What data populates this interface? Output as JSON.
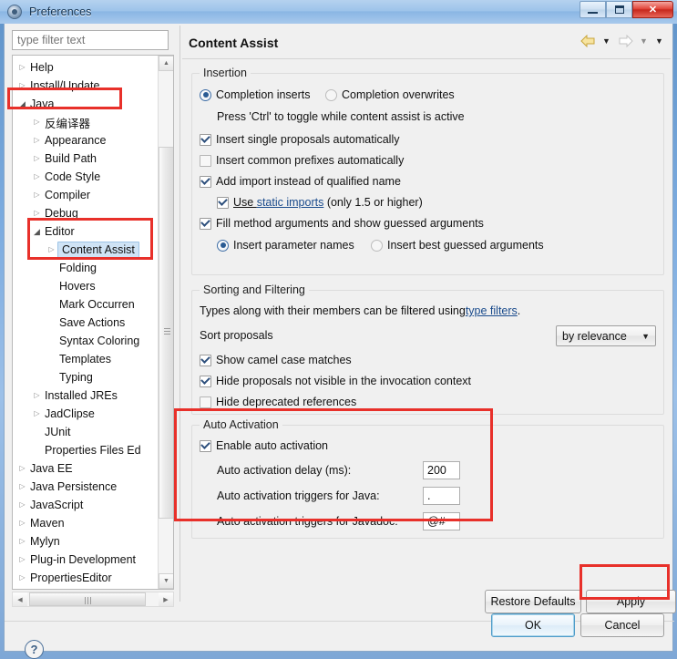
{
  "window": {
    "title": "Preferences",
    "icon": "preferences-gear-icon",
    "minimize_label": "–",
    "maximize_label": "□",
    "close_label": "✕"
  },
  "sidebar": {
    "filter_placeholder": "type filter text",
    "filter_value": "",
    "items": [
      {
        "label": "Help",
        "indent": 0,
        "arrow": "closed",
        "selected": false
      },
      {
        "label": "Install/Update",
        "indent": 0,
        "arrow": "closed",
        "selected": false
      },
      {
        "label": "Java",
        "indent": 0,
        "arrow": "open",
        "selected": false
      },
      {
        "label": "反编译器",
        "indent": 1,
        "arrow": "closed",
        "selected": false
      },
      {
        "label": "Appearance",
        "indent": 1,
        "arrow": "closed",
        "selected": false
      },
      {
        "label": "Build Path",
        "indent": 1,
        "arrow": "closed",
        "selected": false
      },
      {
        "label": "Code Style",
        "indent": 1,
        "arrow": "closed",
        "selected": false
      },
      {
        "label": "Compiler",
        "indent": 1,
        "arrow": "closed",
        "selected": false
      },
      {
        "label": "Debug",
        "indent": 1,
        "arrow": "closed",
        "selected": false
      },
      {
        "label": "Editor",
        "indent": 1,
        "arrow": "open",
        "selected": false
      },
      {
        "label": "Content Assist",
        "indent": 2,
        "arrow": "closed",
        "selected": true
      },
      {
        "label": "Folding",
        "indent": 2,
        "arrow": "none",
        "selected": false
      },
      {
        "label": "Hovers",
        "indent": 2,
        "arrow": "none",
        "selected": false
      },
      {
        "label": "Mark Occurren",
        "indent": 2,
        "arrow": "none",
        "selected": false
      },
      {
        "label": "Save Actions",
        "indent": 2,
        "arrow": "none",
        "selected": false
      },
      {
        "label": "Syntax Coloring",
        "indent": 2,
        "arrow": "none",
        "selected": false
      },
      {
        "label": "Templates",
        "indent": 2,
        "arrow": "none",
        "selected": false
      },
      {
        "label": "Typing",
        "indent": 2,
        "arrow": "none",
        "selected": false
      },
      {
        "label": "Installed JREs",
        "indent": 1,
        "arrow": "closed",
        "selected": false
      },
      {
        "label": "JadClipse",
        "indent": 1,
        "arrow": "closed",
        "selected": false
      },
      {
        "label": "JUnit",
        "indent": 1,
        "arrow": "none",
        "selected": false
      },
      {
        "label": "Properties Files Ed",
        "indent": 1,
        "arrow": "none",
        "selected": false
      },
      {
        "label": "Java EE",
        "indent": 0,
        "arrow": "closed",
        "selected": false
      },
      {
        "label": "Java Persistence",
        "indent": 0,
        "arrow": "closed",
        "selected": false
      },
      {
        "label": "JavaScript",
        "indent": 0,
        "arrow": "closed",
        "selected": false
      },
      {
        "label": "Maven",
        "indent": 0,
        "arrow": "closed",
        "selected": false
      },
      {
        "label": "Mylyn",
        "indent": 0,
        "arrow": "closed",
        "selected": false
      },
      {
        "label": "Plug-in Development",
        "indent": 0,
        "arrow": "closed",
        "selected": false
      },
      {
        "label": "PropertiesEditor",
        "indent": 0,
        "arrow": "closed",
        "selected": false
      }
    ]
  },
  "page": {
    "title": "Content Assist",
    "nav": {
      "back_icon": "back-arrow-icon",
      "back_menu_icon": "chevron-down-icon",
      "forward_icon": "forward-arrow-icon",
      "forward_menu_icon": "chevron-down-icon",
      "view_menu_icon": "chevron-down-icon"
    },
    "insertion": {
      "legend": "Insertion",
      "radio_inserts": "Completion inserts",
      "radio_overwrites": "Completion overwrites",
      "hint": "Press 'Ctrl' to toggle while content assist is active",
      "cb_single": "Insert single proposals automatically",
      "cb_prefixes": "Insert common prefixes automatically",
      "cb_addimport": "Add import instead of qualified name",
      "cb_static_pre": "Use ",
      "cb_static_link": "static imports",
      "cb_static_post": " (only 1.5 or higher)",
      "cb_fillargs": "Fill method arguments and show guessed arguments",
      "radio_paramnames": "Insert parameter names",
      "radio_bestguess": "Insert best guessed arguments"
    },
    "sorting": {
      "legend": "Sorting and Filtering",
      "desc_pre": "Types along with their members can be filtered using ",
      "desc_link": "type filters",
      "desc_post": ".",
      "sort_label": "Sort proposals",
      "sort_value": "by relevance",
      "cb_camel": "Show camel case matches",
      "cb_hide_invisible": "Hide proposals not visible in the invocation context",
      "cb_hide_deprecated": "Hide deprecated references"
    },
    "autoactivation": {
      "legend": "Auto Activation",
      "cb_enable": "Enable auto activation",
      "delay_label": "Auto activation delay (ms):",
      "delay_value": "200",
      "java_label": "Auto activation triggers for Java:",
      "java_value": ".",
      "javadoc_label": "Auto activation triggers for Javadoc:",
      "javadoc_value": "@#"
    }
  },
  "buttons": {
    "restore_defaults": "Restore Defaults",
    "apply": "Apply",
    "ok": "OK",
    "cancel": "Cancel",
    "help_icon": "?"
  },
  "annotations": {
    "highlight_color": "#e8302a",
    "boxes": [
      "java-node",
      "editor-content-assist",
      "auto-activation-group",
      "apply-button"
    ]
  },
  "colors": {
    "accent": "#e8302a",
    "link": "#1a4b8c",
    "selection": "#cfe3f5",
    "dialog_bg": "#f0f0f0"
  }
}
